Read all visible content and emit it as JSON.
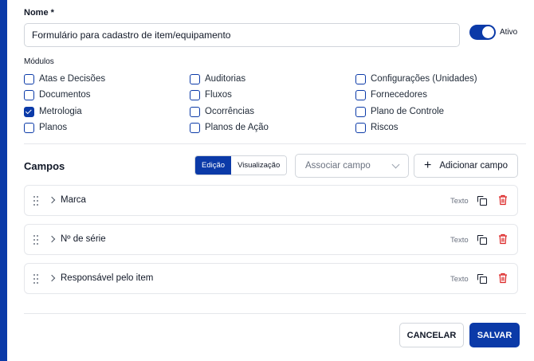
{
  "form": {
    "name_label": "Nome *",
    "name_value": "Formulário para cadastro de item/equipamento",
    "active_label": "Ativo",
    "active": true
  },
  "modules": {
    "label": "Módulos",
    "items": [
      {
        "label": "Atas e Decisões",
        "checked": false
      },
      {
        "label": "Documentos",
        "checked": false
      },
      {
        "label": "Metrologia",
        "checked": true
      },
      {
        "label": "Planos",
        "checked": false
      },
      {
        "label": "Auditorias",
        "checked": false
      },
      {
        "label": "Fluxos",
        "checked": false
      },
      {
        "label": "Ocorrências",
        "checked": false
      },
      {
        "label": "Planos de Ação",
        "checked": false
      },
      {
        "label": "Configurações (Unidades)",
        "checked": false
      },
      {
        "label": "Fornecedores",
        "checked": false
      },
      {
        "label": "Plano de Controle",
        "checked": false
      },
      {
        "label": "Riscos",
        "checked": false
      }
    ]
  },
  "fields": {
    "title": "Campos",
    "view_modes": [
      "Edição",
      "Visualização"
    ],
    "active_view": "Edição",
    "associate_placeholder": "Associar campo",
    "add_label": "Adicionar campo",
    "rows": [
      {
        "name": "Marca",
        "type": "Texto"
      },
      {
        "name": "Nº de série",
        "type": "Texto"
      },
      {
        "name": "Responsável pelo item",
        "type": "Texto"
      }
    ]
  },
  "actions": {
    "cancel": "CANCELAR",
    "save": "SALVAR"
  },
  "colors": {
    "primary": "#0b3aa8",
    "danger": "#dc2626",
    "border": "#d1d5db"
  },
  "icons": [
    "plus-icon",
    "chevron-down-icon",
    "drag-handle-icon",
    "chevron-right-icon",
    "copy-icon",
    "trash-icon"
  ]
}
